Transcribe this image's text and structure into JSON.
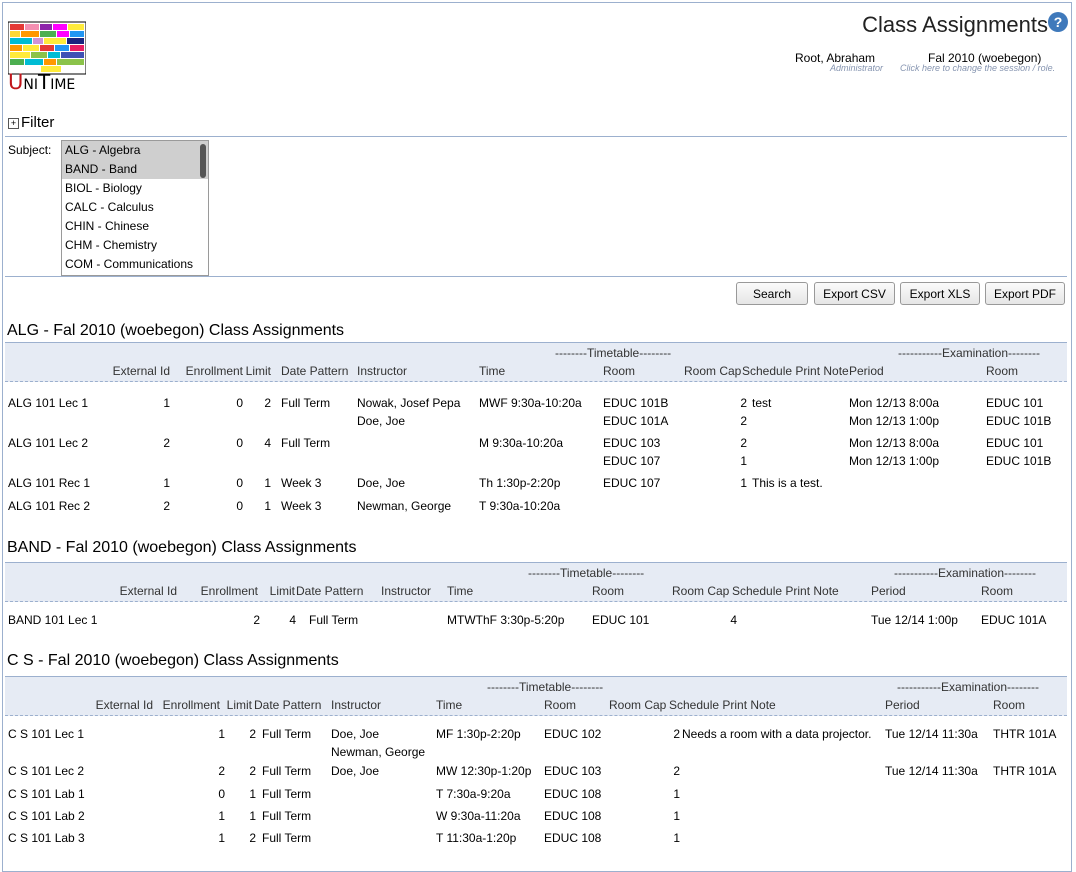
{
  "header": {
    "logo_text_u": "U",
    "logo_text_ni": "NI",
    "logo_text_t": "T",
    "logo_text_ime": "IME",
    "title": "Class Assignments",
    "user_name": "Root, Abraham",
    "user_role": "Administrator",
    "session": "Fal 2010 (woebegon)",
    "session_hint": "Click here to change the session / role."
  },
  "filter": {
    "label": "Filter",
    "subject_label": "Subject:",
    "subjects": [
      {
        "label": "ALG - Algebra",
        "selected": true
      },
      {
        "label": "BAND - Band",
        "selected": true
      },
      {
        "label": "BIOL - Biology",
        "selected": false
      },
      {
        "label": "CALC - Calculus",
        "selected": false
      },
      {
        "label": "CHIN - Chinese",
        "selected": false
      },
      {
        "label": "CHM - Chemistry",
        "selected": false
      },
      {
        "label": "COM - Communications",
        "selected": false
      }
    ]
  },
  "buttons": {
    "search": "Search",
    "csv": "Export CSV",
    "xls": "Export XLS",
    "pdf": "Export PDF"
  },
  "columns": {
    "timetable_group": "--------Timetable--------",
    "exam_group": "-----------Examination--------",
    "external_id": "External Id",
    "enrollment": "Enrollment",
    "limit": "Limit",
    "date_pattern": "Date Pattern",
    "instructor": "Instructor",
    "time": "Time",
    "room": "Room",
    "room_cap": "Room Cap",
    "note": "Schedule Print Note",
    "period": "Period",
    "exam_room": "Room"
  },
  "sections": [
    {
      "title": "ALG - Fal 2010 (woebegon) Class Assignments",
      "rows": [
        {
          "name": "ALG 101 Lec 1",
          "ext": "1",
          "enr": "0",
          "lim": "2",
          "dp": "Full Term",
          "instr": [
            "Nowak, Josef Pepa",
            "Doe, Joe"
          ],
          "time": "MWF 9:30a-10:20a",
          "room": [
            "EDUC 101B",
            "EDUC 101A"
          ],
          "cap": [
            "2",
            "2"
          ],
          "note": "test",
          "period": [
            "Mon 12/13 8:00a",
            "Mon 12/13 1:00p"
          ],
          "eroom": [
            "EDUC 101",
            "EDUC 101B"
          ]
        },
        {
          "name": "ALG 101 Lec 2",
          "ext": "2",
          "enr": "0",
          "lim": "4",
          "dp": "Full Term",
          "instr": [],
          "time": "M 9:30a-10:20a",
          "room": [
            "EDUC 103",
            "EDUC 107"
          ],
          "cap": [
            "2",
            "1"
          ],
          "note": "",
          "period": [
            "Mon 12/13 8:00a",
            "Mon 12/13 1:00p"
          ],
          "eroom": [
            "EDUC 101",
            "EDUC 101B"
          ]
        },
        {
          "name": "ALG 101 Rec 1",
          "ext": "1",
          "enr": "0",
          "lim": "1",
          "dp": "Week 3",
          "instr": [
            "Doe, Joe"
          ],
          "time": "Th 1:30p-2:20p",
          "room": [
            "EDUC 107"
          ],
          "cap": [
            "1"
          ],
          "note": "This is a test.",
          "period": [],
          "eroom": []
        },
        {
          "name": "ALG 101 Rec 2",
          "ext": "2",
          "enr": "0",
          "lim": "1",
          "dp": "Week 3",
          "instr": [
            "Newman, George"
          ],
          "time": "T 9:30a-10:20a",
          "room": [],
          "cap": [],
          "note": "",
          "period": [],
          "eroom": []
        }
      ]
    },
    {
      "title": "BAND - Fal 2010 (woebegon) Class Assignments",
      "rows": [
        {
          "name": "BAND 101 Lec 1",
          "ext": "",
          "enr": "2",
          "lim": "4",
          "dp": "Full Term",
          "instr": [],
          "time": "MTWThF 3:30p-5:20p",
          "room": [
            "EDUC 101"
          ],
          "cap": [
            "4"
          ],
          "note": "",
          "period": [
            "Tue 12/14 1:00p"
          ],
          "eroom": [
            "EDUC 101A"
          ]
        }
      ]
    },
    {
      "title": "C S - Fal 2010 (woebegon) Class Assignments",
      "rows": [
        {
          "name": "C S 101 Lec 1",
          "ext": "",
          "enr": "1",
          "lim": "2",
          "dp": "Full Term",
          "instr": [
            "Doe, Joe",
            "Newman, George"
          ],
          "time": "MF 1:30p-2:20p",
          "room": [
            "EDUC 102"
          ],
          "cap": [
            "2"
          ],
          "note": "Needs a room with a data projector.",
          "period": [
            "Tue 12/14 11:30a"
          ],
          "eroom": [
            "THTR 101A"
          ]
        },
        {
          "name": "C S 101 Lec 2",
          "ext": "",
          "enr": "2",
          "lim": "2",
          "dp": "Full Term",
          "instr": [
            "Doe, Joe"
          ],
          "time": "MW 12:30p-1:20p",
          "room": [
            "EDUC 103"
          ],
          "cap": [
            "2"
          ],
          "note": "",
          "period": [
            "Tue 12/14 11:30a"
          ],
          "eroom": [
            "THTR 101A"
          ]
        },
        {
          "name": "C S 101 Lab 1",
          "ext": "",
          "enr": "0",
          "lim": "1",
          "dp": "Full Term",
          "instr": [],
          "time": "T 7:30a-9:20a",
          "room": [
            "EDUC 108"
          ],
          "cap": [
            "1"
          ],
          "note": "",
          "period": [],
          "eroom": []
        },
        {
          "name": "C S 101 Lab 2",
          "ext": "",
          "enr": "1",
          "lim": "1",
          "dp": "Full Term",
          "instr": [],
          "time": "W 9:30a-11:20a",
          "room": [
            "EDUC 108"
          ],
          "cap": [
            "1"
          ],
          "note": "",
          "period": [],
          "eroom": []
        },
        {
          "name": "C S 101 Lab 3",
          "ext": "",
          "enr": "1",
          "lim": "2",
          "dp": "Full Term",
          "instr": [],
          "time": "T 11:30a-1:20p",
          "room": [
            "EDUC 108"
          ],
          "cap": [
            "1"
          ],
          "note": "",
          "period": [],
          "eroom": []
        }
      ]
    }
  ]
}
